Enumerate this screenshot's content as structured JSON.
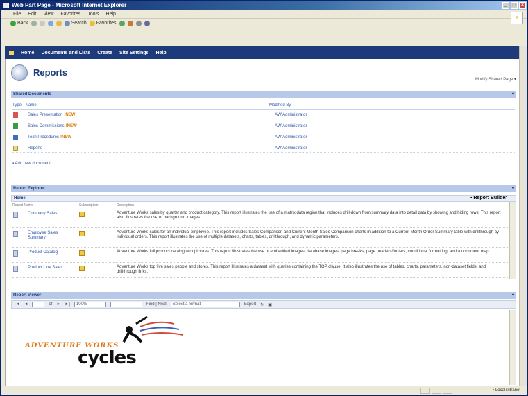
{
  "window": {
    "title": "Web Part Page - Microsoft Internet Explorer"
  },
  "menu": [
    "File",
    "Edit",
    "View",
    "Favorites",
    "Tools",
    "Help"
  ],
  "toolbar": {
    "back": "Back",
    "search": "Search",
    "favorites": "Favorites"
  },
  "nav": {
    "items": [
      "Home",
      "Documents and Lists",
      "Create",
      "Site Settings",
      "Help"
    ]
  },
  "page": {
    "title": "Reports",
    "modify_link": "Modify Shared Page ▾"
  },
  "shared_documents": {
    "title": "Shared Documents",
    "col_type": "Type",
    "col_name": "Name",
    "col_modified": "Modified By",
    "rows": [
      {
        "name": "Sales Presentation",
        "is_new": "!NEW",
        "modified_by": "AW\\Administrator"
      },
      {
        "name": "Sales Commissions",
        "is_new": "!NEW",
        "modified_by": "AW\\Administrator"
      },
      {
        "name": "Tech Procedures",
        "is_new": "!NEW",
        "modified_by": "AW\\Administrator"
      },
      {
        "name": "Reports",
        "is_new": "",
        "modified_by": "AW\\Administrator"
      }
    ],
    "add_link": "Add new document"
  },
  "report_explorer": {
    "title": "Report Explorer",
    "home_label": "Home",
    "builder_label": "Report Builder",
    "col_name": "Report Name",
    "col_subscription": "Subscription",
    "col_description": "Description",
    "rows": [
      {
        "name": "Company Sales",
        "description": "Adventure Works sales by quarter and product category. This report illustrates the use of a matrix data region that includes drill-down from summary data into detail data by showing and hiding rows. This report also illustrates the use of background images."
      },
      {
        "name": "Employee Sales Summary",
        "description": "Adventure Works sales for an individual employee. This report includes Sales Comparison and Current Month Sales Comparison charts in addition to a Current Month Order Summary table with drillthrough by individual orders. This report illustrates the use of multiple datasets, charts, tables, drillthrough, and dynamic parameters."
      },
      {
        "name": "Product Catalog",
        "description": "Adventure Works full product catalog with pictures. This report illustrates the use of embedded images, database images, page breaks, page headers/footers, conditional formatting, and a document map."
      },
      {
        "name": "Product Line Sales",
        "description": "Adventure Works top five sales people and stores. This report illustrates a dataset with queries containing the TOP clause. It also illustrates the use of tables, charts, parameters, non-dataset fields, and drillthrough links."
      }
    ]
  },
  "report_viewer": {
    "title": "Report Viewer",
    "page_label": "of",
    "zoom": "100%",
    "find_label": "Find | Next",
    "export_label": "Select a format",
    "export_btn": "Export",
    "logo_text": "ADVENTURE WORKS",
    "logo_cycles": "cycles"
  },
  "status": {
    "zone": "Local intranet"
  }
}
